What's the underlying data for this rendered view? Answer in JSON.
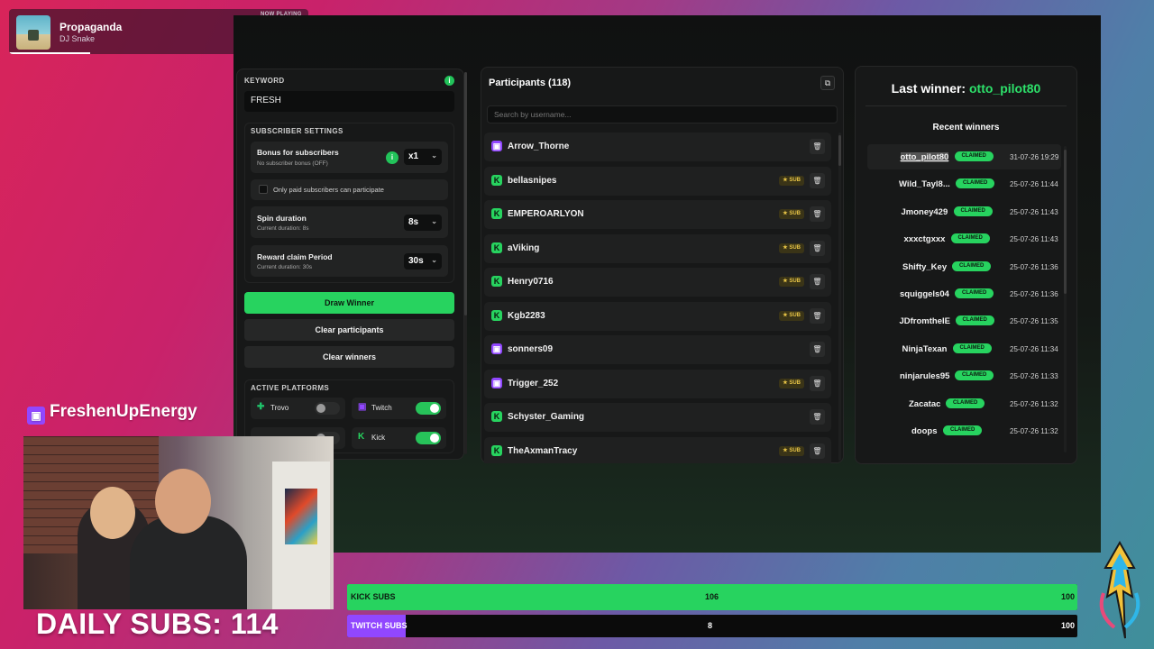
{
  "now_playing": {
    "tag": "NOW PLAYING",
    "title": "Propaganda",
    "artist": "DJ Snake"
  },
  "settings": {
    "keyword_label": "KEYWORD",
    "keyword_value": "FRESH",
    "subscriber_settings_label": "SUBSCRIBER SETTINGS",
    "bonus_title": "Bonus for subscribers",
    "bonus_sub": "No subscriber bonus (OFF)",
    "bonus_value": "x1",
    "paid_only": "Only paid subscribers can participate",
    "spin_title": "Spin duration",
    "spin_sub": "Current duration: 8s",
    "spin_value": "8s",
    "claim_title": "Reward claim Period",
    "claim_sub": "Current duration: 30s",
    "claim_value": "30s",
    "draw_winner": "Draw Winner",
    "clear_participants": "Clear participants",
    "clear_winners": "Clear winners",
    "platforms_label": "ACTIVE PLATFORMS",
    "platforms": [
      {
        "name": "Trovo",
        "enabled": false
      },
      {
        "name": "Twitch",
        "enabled": true
      },
      {
        "name": "",
        "enabled": false
      },
      {
        "name": "Kick",
        "enabled": true
      }
    ]
  },
  "participants": {
    "title": "Participants (118)",
    "search_placeholder": "Search by username...",
    "sub_badge": "★ SUB",
    "items": [
      {
        "name": "Arrow_Thorne",
        "platform": "twitch",
        "sub": false
      },
      {
        "name": "bellasnipes",
        "platform": "kick",
        "sub": true
      },
      {
        "name": "EMPEROARLYON",
        "platform": "kick",
        "sub": true
      },
      {
        "name": "aViking",
        "platform": "kick",
        "sub": true
      },
      {
        "name": "Henry0716",
        "platform": "kick",
        "sub": true
      },
      {
        "name": "Kgb2283",
        "platform": "kick",
        "sub": true
      },
      {
        "name": "sonners09",
        "platform": "twitch",
        "sub": false
      },
      {
        "name": "Trigger_252",
        "platform": "twitch",
        "sub": true
      },
      {
        "name": "Schyster_Gaming",
        "platform": "kick",
        "sub": false
      },
      {
        "name": "TheAxmanTracy",
        "platform": "kick",
        "sub": true
      }
    ]
  },
  "winners": {
    "last_label": "Last winner: ",
    "last_name": "otto_pilot80",
    "recent_title": "Recent winners",
    "claimed_label": "CLAIMED",
    "items": [
      {
        "name": "otto_pilot80",
        "date": "31-07-26 19:29"
      },
      {
        "name": "Wild_Tayl8...",
        "date": "25-07-26 11:44"
      },
      {
        "name": "Jmoney429",
        "date": "25-07-26 11:43"
      },
      {
        "name": "xxxctgxxx",
        "date": "25-07-26 11:43"
      },
      {
        "name": "Shifty_Key",
        "date": "25-07-26 11:36"
      },
      {
        "name": "squiggels04",
        "date": "25-07-26 11:36"
      },
      {
        "name": "JDfromtheIE",
        "date": "25-07-26 11:35"
      },
      {
        "name": "NinjaTexan",
        "date": "25-07-26 11:34"
      },
      {
        "name": "ninjarules95",
        "date": "25-07-26 11:33"
      },
      {
        "name": "Zacatac",
        "date": "25-07-26 11:32"
      },
      {
        "name": "doops",
        "date": "25-07-26 11:32"
      }
    ]
  },
  "overlay": {
    "channel": "FreshenUpEnergy",
    "daily_subs": "DAILY SUBS: 114",
    "kick_label": "KICK SUBS",
    "kick_value": "106",
    "kick_max": "100",
    "kick_progress": 1.0,
    "kick_color": "#27d35f",
    "twitch_label": "TWITCH SUBS",
    "twitch_value": "8",
    "twitch_max": "100",
    "twitch_progress": 0.08,
    "twitch_color": "#9147ff"
  }
}
